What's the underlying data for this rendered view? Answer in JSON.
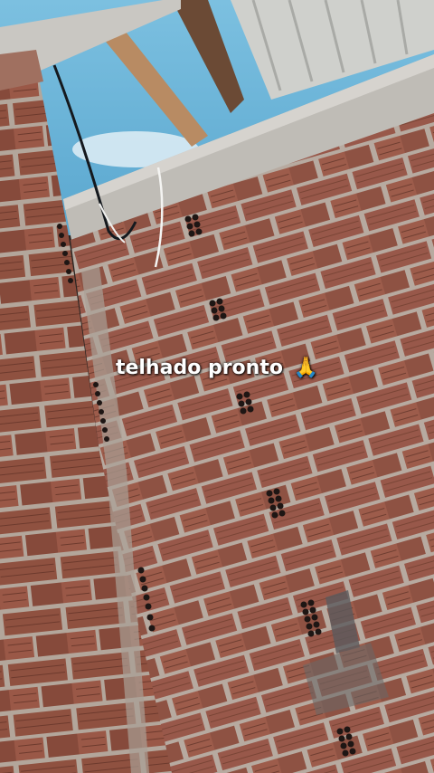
{
  "overlay": {
    "caption_text": "telhado pronto",
    "caption_emoji": "🙏"
  },
  "colors": {
    "sky": "#6fb6d8",
    "brick": "#9a5a47",
    "brick_dark": "#6e3c2f",
    "mortar": "#b8aca2",
    "concrete": "#bdbab5"
  }
}
